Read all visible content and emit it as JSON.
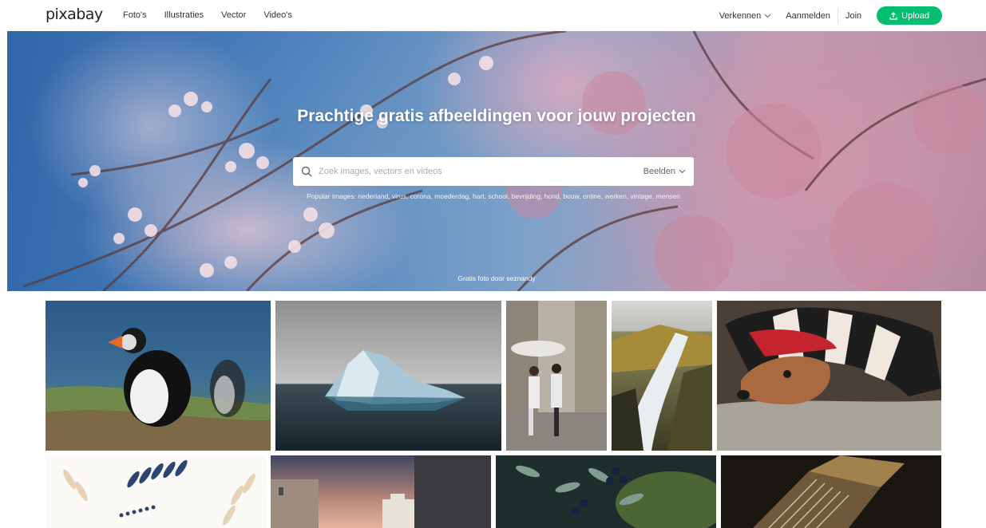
{
  "header": {
    "logo": "pixabay",
    "nav": [
      "Foto's",
      "Illustraties",
      "Vector",
      "Video's"
    ],
    "explore_label": "Verkennen",
    "login_label": "Aanmelden",
    "join_label": "Join",
    "upload_label": "Upload"
  },
  "hero": {
    "title": "Prachtige gratis afbeeldingen voor jouw projecten",
    "search": {
      "placeholder": "Zoek images, vectors en videos",
      "type_label": "Beelden"
    },
    "popular_text": "Popular Images: nederland, virus, corona, moederdag, hart, school, bevrijding, hond, bouw, online, werken, vintage, mensen",
    "credit": "Gratis foto door seznandy"
  },
  "colors": {
    "brand_green": "#02be6e"
  },
  "icons": {
    "search": "search-icon",
    "upload": "upload-icon",
    "chevron": "chevron-down-icon"
  }
}
